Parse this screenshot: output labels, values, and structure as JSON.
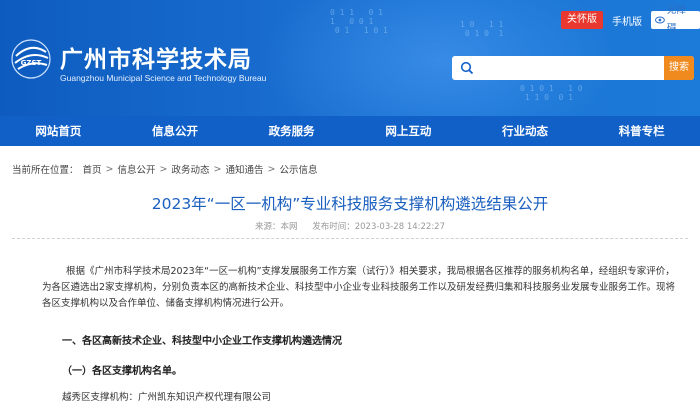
{
  "header": {
    "site_title": "广州市科学技术局",
    "site_subtitle": "Guangzhou Municipal Science and Technology Bureau",
    "logo_text": "GZST",
    "care_version": "关怀版",
    "mobile_version": "手机版",
    "accessibility": "无障碍",
    "search_placeholder": "",
    "search_button": "搜索"
  },
  "nav": {
    "items": [
      {
        "label": "网站首页"
      },
      {
        "label": "信息公开"
      },
      {
        "label": "政务服务"
      },
      {
        "label": "网上互动"
      },
      {
        "label": "行业动态"
      },
      {
        "label": "科普专栏"
      }
    ]
  },
  "breadcrumb": {
    "prefix": "当前所在位置：",
    "items": [
      "首页",
      "信息公开",
      "政务动态",
      "通知通告",
      "公示信息"
    ],
    "separator": ">"
  },
  "article": {
    "title": "2023年“一区一机构”专业科技服务支撑机构遴选结果公开",
    "source": "来源：本网",
    "published": "发布时间：2023-03-28 14:22:27",
    "paragraph": "根据《广州市科学技术局2023年“一区一机构”支撑发展服务工作方案（试行）》相关要求，我局根据各区推荐的服务机构名单，经组织专家评价，为各区遴选出2家支撑机构，分别负责本区的高新技术企业、科技型中小企业专业科技服务工作以及研发经费归集和科技服务业发展专业服务工作。现将各区支撑机构以及合作单位、储备支撑机构情况进行公开。",
    "heading1": "一、各区高新技术企业、科技型中小企业工作支撑机构遴选情况",
    "heading2": "（一）各区支撑机构名单。",
    "line3": "越秀区支撑机构：广州凯东知识产权代理有限公司"
  }
}
